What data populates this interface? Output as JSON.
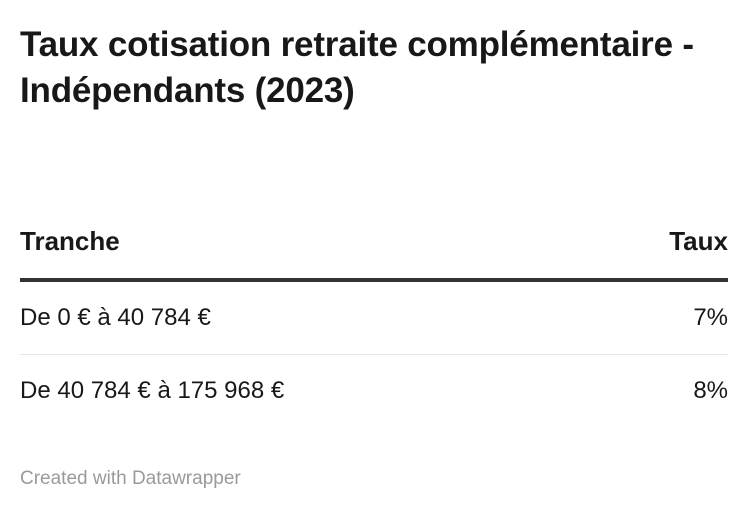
{
  "chart_data": {
    "type": "table",
    "title": "Taux cotisation retraite complémentaire - Indépendants (2023)",
    "columns": [
      "Tranche",
      "Taux"
    ],
    "rows": [
      [
        "De 0 € à 40 784 €",
        "7%"
      ],
      [
        "De 40 784 € à 175 968 €",
        "8%"
      ]
    ]
  },
  "footer": {
    "credit": "Created with Datawrapper"
  },
  "colors": {
    "text": "#181818",
    "header_rule": "#333333",
    "row_rule": "#e6e6e6",
    "footer_text": "#9a9a9a"
  }
}
